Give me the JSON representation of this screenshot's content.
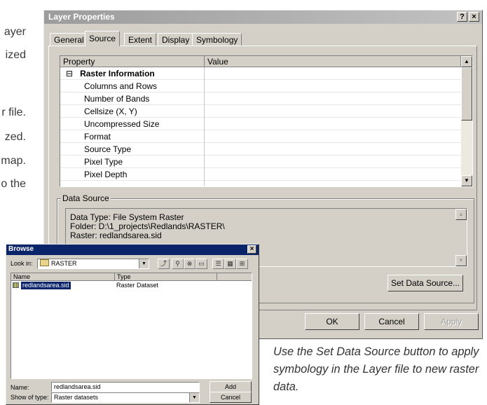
{
  "page_text": {
    "fragments": [
      "ayer",
      "ized",
      "r file.",
      "zed.",
      "map.",
      "o the"
    ],
    "caption": "Use the Set Data Source button to apply symbology in the Layer file to new raster data."
  },
  "layer_dialog": {
    "title": "Layer Properties",
    "help_btn": "?",
    "close_btn": "×",
    "tabs": [
      "General",
      "Source",
      "Extent",
      "Display",
      "Symbology"
    ],
    "active_tab": "Source",
    "grid": {
      "col_property": "Property",
      "col_value": "Value",
      "group_toggle": "⊟",
      "group_label": "Raster Information",
      "rows": [
        "Columns and Rows",
        "Number of Bands",
        "Cellsize (X, Y)",
        "Uncompressed Size",
        "Format",
        "Source Type",
        "Pixel Type",
        "Pixel Depth"
      ]
    },
    "data_source": {
      "legend": "Data Source",
      "lines": [
        "Data Type: File System Raster",
        "Folder: D:\\1_projects\\Redlands\\RASTER\\",
        "Raster: redlandsarea.sid"
      ],
      "set_button": "Set Data Source..."
    },
    "buttons": {
      "ok": "OK",
      "cancel": "Cancel",
      "apply": "Apply"
    }
  },
  "browse_dialog": {
    "title": "Browse",
    "close_btn": "×",
    "look_in_label": "Look in:",
    "look_in_value": "RASTER",
    "col_name": "Name",
    "col_type": "Type",
    "items": [
      {
        "name": "redlandsarea.sid",
        "type": "Raster Dataset",
        "selected": true
      }
    ],
    "name_label": "Name:",
    "name_value": "redlandsarea.sid",
    "type_label": "Show of type:",
    "type_value": "Raster datasets",
    "add_button": "Add",
    "cancel_button": "Cancel"
  },
  "colors": {
    "dialog_face": "#d4d0c8",
    "browse_title": "#0a246a",
    "selection": "#0a246a"
  }
}
